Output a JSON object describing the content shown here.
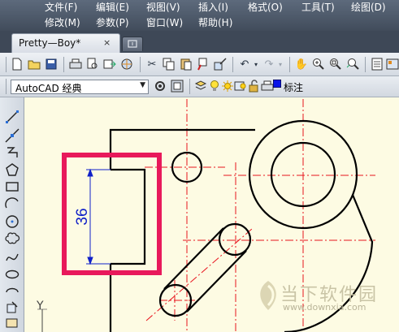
{
  "menu": {
    "row1": [
      "文件(F)",
      "编辑(E)",
      "视图(V)",
      "插入(I)",
      "格式(O)",
      "工具(T)",
      "绘图(D)"
    ],
    "row2": [
      "修改(M)",
      "参数(P)",
      "窗口(W)",
      "帮助(H)"
    ]
  },
  "tabs": {
    "document_tab": "Pretty—Boy*",
    "close_glyph": "×"
  },
  "workspace": {
    "selected": "AutoCAD 经典"
  },
  "layer": {
    "current": "标注"
  },
  "drawing": {
    "dimension_text": "36",
    "y_axis_label": "Y",
    "highlight_color": "#e8195b",
    "centerline_color": "#e8141e"
  },
  "watermark": {
    "text": "当下软件园",
    "url": "www.downxia.com"
  }
}
